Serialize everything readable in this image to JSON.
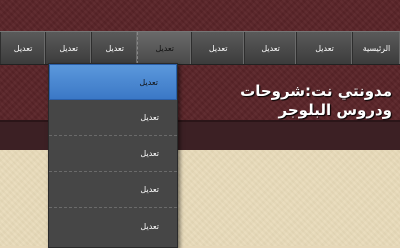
{
  "nav": {
    "items": [
      {
        "label": "الرئيسية"
      },
      {
        "label": "تعديل"
      },
      {
        "label": "تعديل"
      },
      {
        "label": "تعديل"
      },
      {
        "label": "تعديل"
      },
      {
        "label": "تعديل"
      },
      {
        "label": "تعديل"
      },
      {
        "label": "تعديل"
      }
    ]
  },
  "dropdown": {
    "items": [
      {
        "label": "تعديل"
      },
      {
        "label": "تعديل"
      },
      {
        "label": "تعديل"
      },
      {
        "label": "تعديل"
      },
      {
        "label": "تعديل"
      }
    ]
  },
  "header": {
    "blog_title": "مدونتي نت:شروحات ودروس البلوجر"
  },
  "colors": {
    "header_bg": "#5a2428",
    "body_bg": "#e8dab9",
    "navbar": "#4a4a4a",
    "dropdown_highlight": "#4a87d0"
  }
}
